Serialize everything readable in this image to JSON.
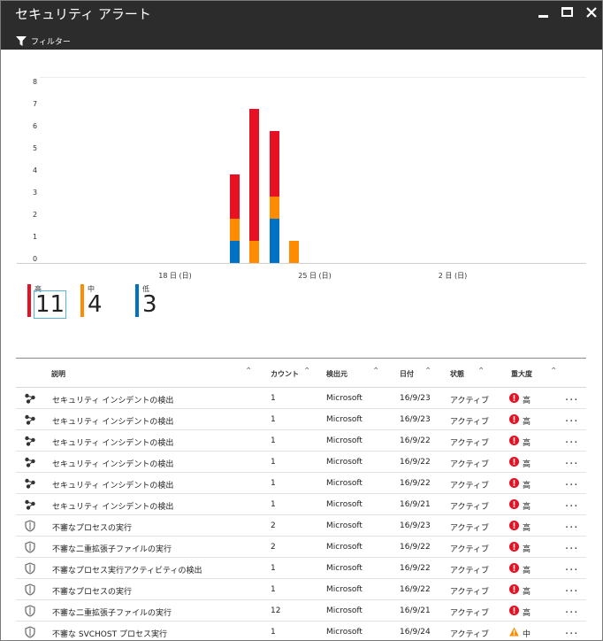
{
  "window": {
    "title": "セキュリティ アラート",
    "filter_label": "フィルター"
  },
  "chart_data": {
    "type": "bar",
    "stacked": true,
    "ylim": [
      0,
      8
    ],
    "y_ticks": [
      "8",
      "7",
      "6",
      "5",
      "4",
      "3",
      "2",
      "1",
      "0"
    ],
    "x_tick_labels": [
      "18 日 (日)",
      "25 日 (日)",
      "2 日 (日)"
    ],
    "colors": {
      "high": "#e81123",
      "medium": "#ff8c00",
      "low": "#0072c6"
    },
    "stacks": [
      {
        "low": 1,
        "medium": 1,
        "high": 2
      },
      {
        "low": 0,
        "medium": 1,
        "high": 6
      },
      {
        "low": 2,
        "medium": 1,
        "high": 3
      },
      {
        "low": 0,
        "medium": 1,
        "high": 0
      }
    ]
  },
  "severity_summary": [
    {
      "label": "高",
      "count": "11",
      "color": "#e81123"
    },
    {
      "label": "中",
      "count": "4",
      "color": "#ff8c00"
    },
    {
      "label": "低",
      "count": "3",
      "color": "#0072c6"
    }
  ],
  "table": {
    "headers": {
      "description": "説明",
      "count": "カウント",
      "source": "検出元",
      "date": "日付",
      "state": "状態",
      "severity": "重大度"
    },
    "more_label": "...",
    "rows": [
      {
        "icon": "incident-icon",
        "description": "セキュリティ インシデントの検出",
        "count": "1",
        "source": "Microsoft",
        "date": "16/9/23",
        "state": "アクティブ",
        "severity": "高",
        "severity_icon": "error-icon"
      },
      {
        "icon": "incident-icon",
        "description": "セキュリティ インシデントの検出",
        "count": "1",
        "source": "Microsoft",
        "date": "16/9/23",
        "state": "アクティブ",
        "severity": "高",
        "severity_icon": "error-icon"
      },
      {
        "icon": "incident-icon",
        "description": "セキュリティ インシデントの検出",
        "count": "1",
        "source": "Microsoft",
        "date": "16/9/22",
        "state": "アクティブ",
        "severity": "高",
        "severity_icon": "error-icon"
      },
      {
        "icon": "incident-icon",
        "description": "セキュリティ インシデントの検出",
        "count": "1",
        "source": "Microsoft",
        "date": "16/9/22",
        "state": "アクティブ",
        "severity": "高",
        "severity_icon": "error-icon"
      },
      {
        "icon": "incident-icon",
        "description": "セキュリティ インシデントの検出",
        "count": "1",
        "source": "Microsoft",
        "date": "16/9/22",
        "state": "アクティブ",
        "severity": "高",
        "severity_icon": "error-icon"
      },
      {
        "icon": "incident-icon",
        "description": "セキュリティ インシデントの検出",
        "count": "1",
        "source": "Microsoft",
        "date": "16/9/21",
        "state": "アクティブ",
        "severity": "高",
        "severity_icon": "error-icon"
      },
      {
        "icon": "shield-icon",
        "description": "不審なプロセスの実行",
        "count": "2",
        "source": "Microsoft",
        "date": "16/9/23",
        "state": "アクティブ",
        "severity": "高",
        "severity_icon": "error-icon"
      },
      {
        "icon": "shield-icon",
        "description": "不審な二重拡張子ファイルの実行",
        "count": "2",
        "source": "Microsoft",
        "date": "16/9/22",
        "state": "アクティブ",
        "severity": "高",
        "severity_icon": "error-icon"
      },
      {
        "icon": "shield-icon",
        "description": "不審なプロセス実行アクティビティの検出",
        "count": "1",
        "source": "Microsoft",
        "date": "16/9/22",
        "state": "アクティブ",
        "severity": "高",
        "severity_icon": "error-icon"
      },
      {
        "icon": "shield-icon",
        "description": "不審なプロセスの実行",
        "count": "1",
        "source": "Microsoft",
        "date": "16/9/22",
        "state": "アクティブ",
        "severity": "高",
        "severity_icon": "error-icon"
      },
      {
        "icon": "shield-icon",
        "description": "不審な二重拡張子ファイルの実行",
        "count": "12",
        "source": "Microsoft",
        "date": "16/9/21",
        "state": "アクティブ",
        "severity": "高",
        "severity_icon": "error-icon"
      },
      {
        "icon": "shield-icon",
        "description": "不審な SVCHOST プロセス実行",
        "count": "1",
        "source": "Microsoft",
        "date": "16/9/24",
        "state": "アクティブ",
        "severity": "中",
        "severity_icon": "warning-icon"
      }
    ]
  }
}
